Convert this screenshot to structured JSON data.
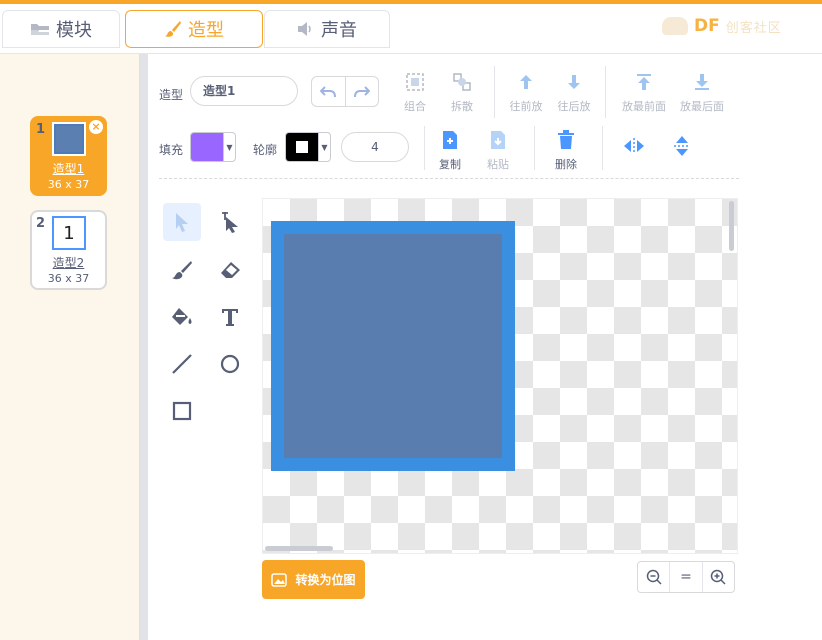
{
  "tabs": {
    "blocks": "模块",
    "costumes": "造型",
    "sounds": "声音"
  },
  "logo": {
    "brand": "DF",
    "text": "创客社区"
  },
  "costumes": [
    {
      "index": "1",
      "name": "造型1",
      "size": "36 x 37",
      "selected": true
    },
    {
      "index": "2",
      "name": "造型2",
      "size": "36 x 37",
      "selected": false,
      "thumb_glyph": "1"
    }
  ],
  "toolbar": {
    "costume_label": "造型",
    "costume_name": "造型1",
    "group": "组合",
    "ungroup": "拆散",
    "forward": "往前放",
    "backward": "往后放",
    "front": "放最前面",
    "back": "放最后面",
    "fill_label": "填充",
    "outline_label": "轮廓",
    "outline_width": "4",
    "copy": "复制",
    "paste": "粘贴",
    "delete": "删除"
  },
  "colors": {
    "accent": "#f7a627",
    "fill": "#9966ff",
    "outline": "#000000",
    "shape_fill": "#5a7daf",
    "shape_stroke": "#3a8fe0"
  },
  "canvas": {
    "convert_button": "转换为位图"
  },
  "zoom": {
    "out": "−",
    "reset": "=",
    "in": "+"
  }
}
